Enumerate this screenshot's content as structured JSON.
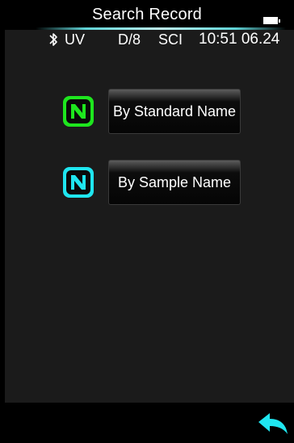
{
  "header": {
    "title": "Search Record"
  },
  "status_bar": {
    "bluetooth_icon": "bluetooth-icon",
    "light_source": "UV",
    "geometry": "D/8",
    "mode": "SCI",
    "time": "10:51 06.24",
    "battery_icon": "battery-icon"
  },
  "options": [
    {
      "label": "By Standard Name",
      "icon": "standard-n-icon",
      "icon_color": "#1ee61e"
    },
    {
      "label": "By Sample Name",
      "icon": "sample-n-icon",
      "icon_color": "#1fe6f0"
    }
  ],
  "footer": {
    "back_icon": "back-arrow-icon",
    "back_icon_color": "#1fe6f0"
  }
}
